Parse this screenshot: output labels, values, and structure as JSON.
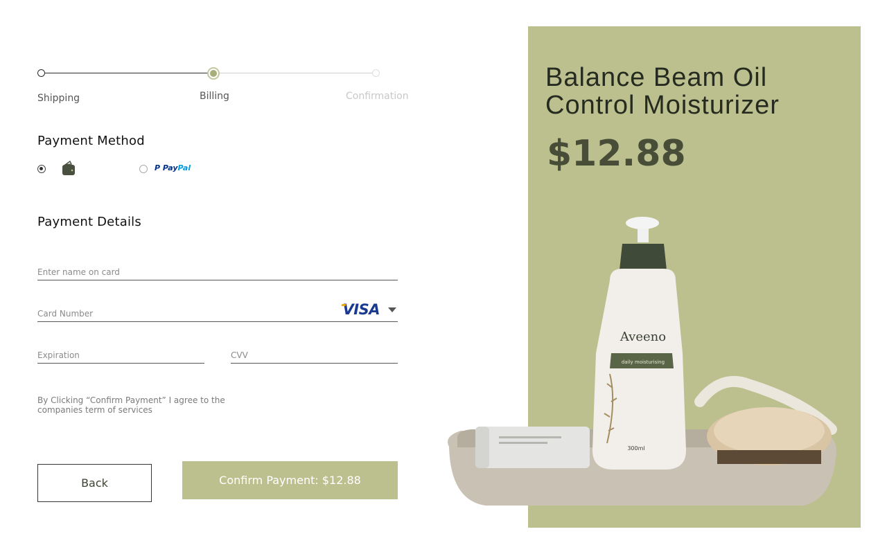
{
  "stepper": {
    "steps": [
      {
        "label": "Shipping",
        "state": "done"
      },
      {
        "label": "Billing",
        "state": "active"
      },
      {
        "label": "Confirmation",
        "state": "upcoming"
      }
    ]
  },
  "payment_method": {
    "title": "Payment Method",
    "options": [
      {
        "icon": "wallet-icon",
        "selected": true
      },
      {
        "logo": "PayPal",
        "logo_parts": [
          "Pay",
          "Pal"
        ],
        "selected": false
      }
    ]
  },
  "payment_details": {
    "title": "Payment Details",
    "name_placeholder": "Enter name on card",
    "card_placeholder": "Card Number",
    "card_brand": "VISA",
    "expiration_placeholder": "Expiration",
    "cvv_placeholder": "CVV"
  },
  "terms": "By Clicking “Confirm Payment” I agree to the companies term of services",
  "buttons": {
    "back": "Back",
    "confirm": "Confirm Payment: $12.88"
  },
  "product": {
    "title": "Balance Beam Oil Control Moisturizer",
    "price": "$12.88",
    "image_bottle_brand": "Aveeno",
    "image_bottle_sub": "daily moisturising",
    "image_bottle_volume": "300ml"
  },
  "colors": {
    "accent": "#bcc08f",
    "price": "#474d37"
  }
}
